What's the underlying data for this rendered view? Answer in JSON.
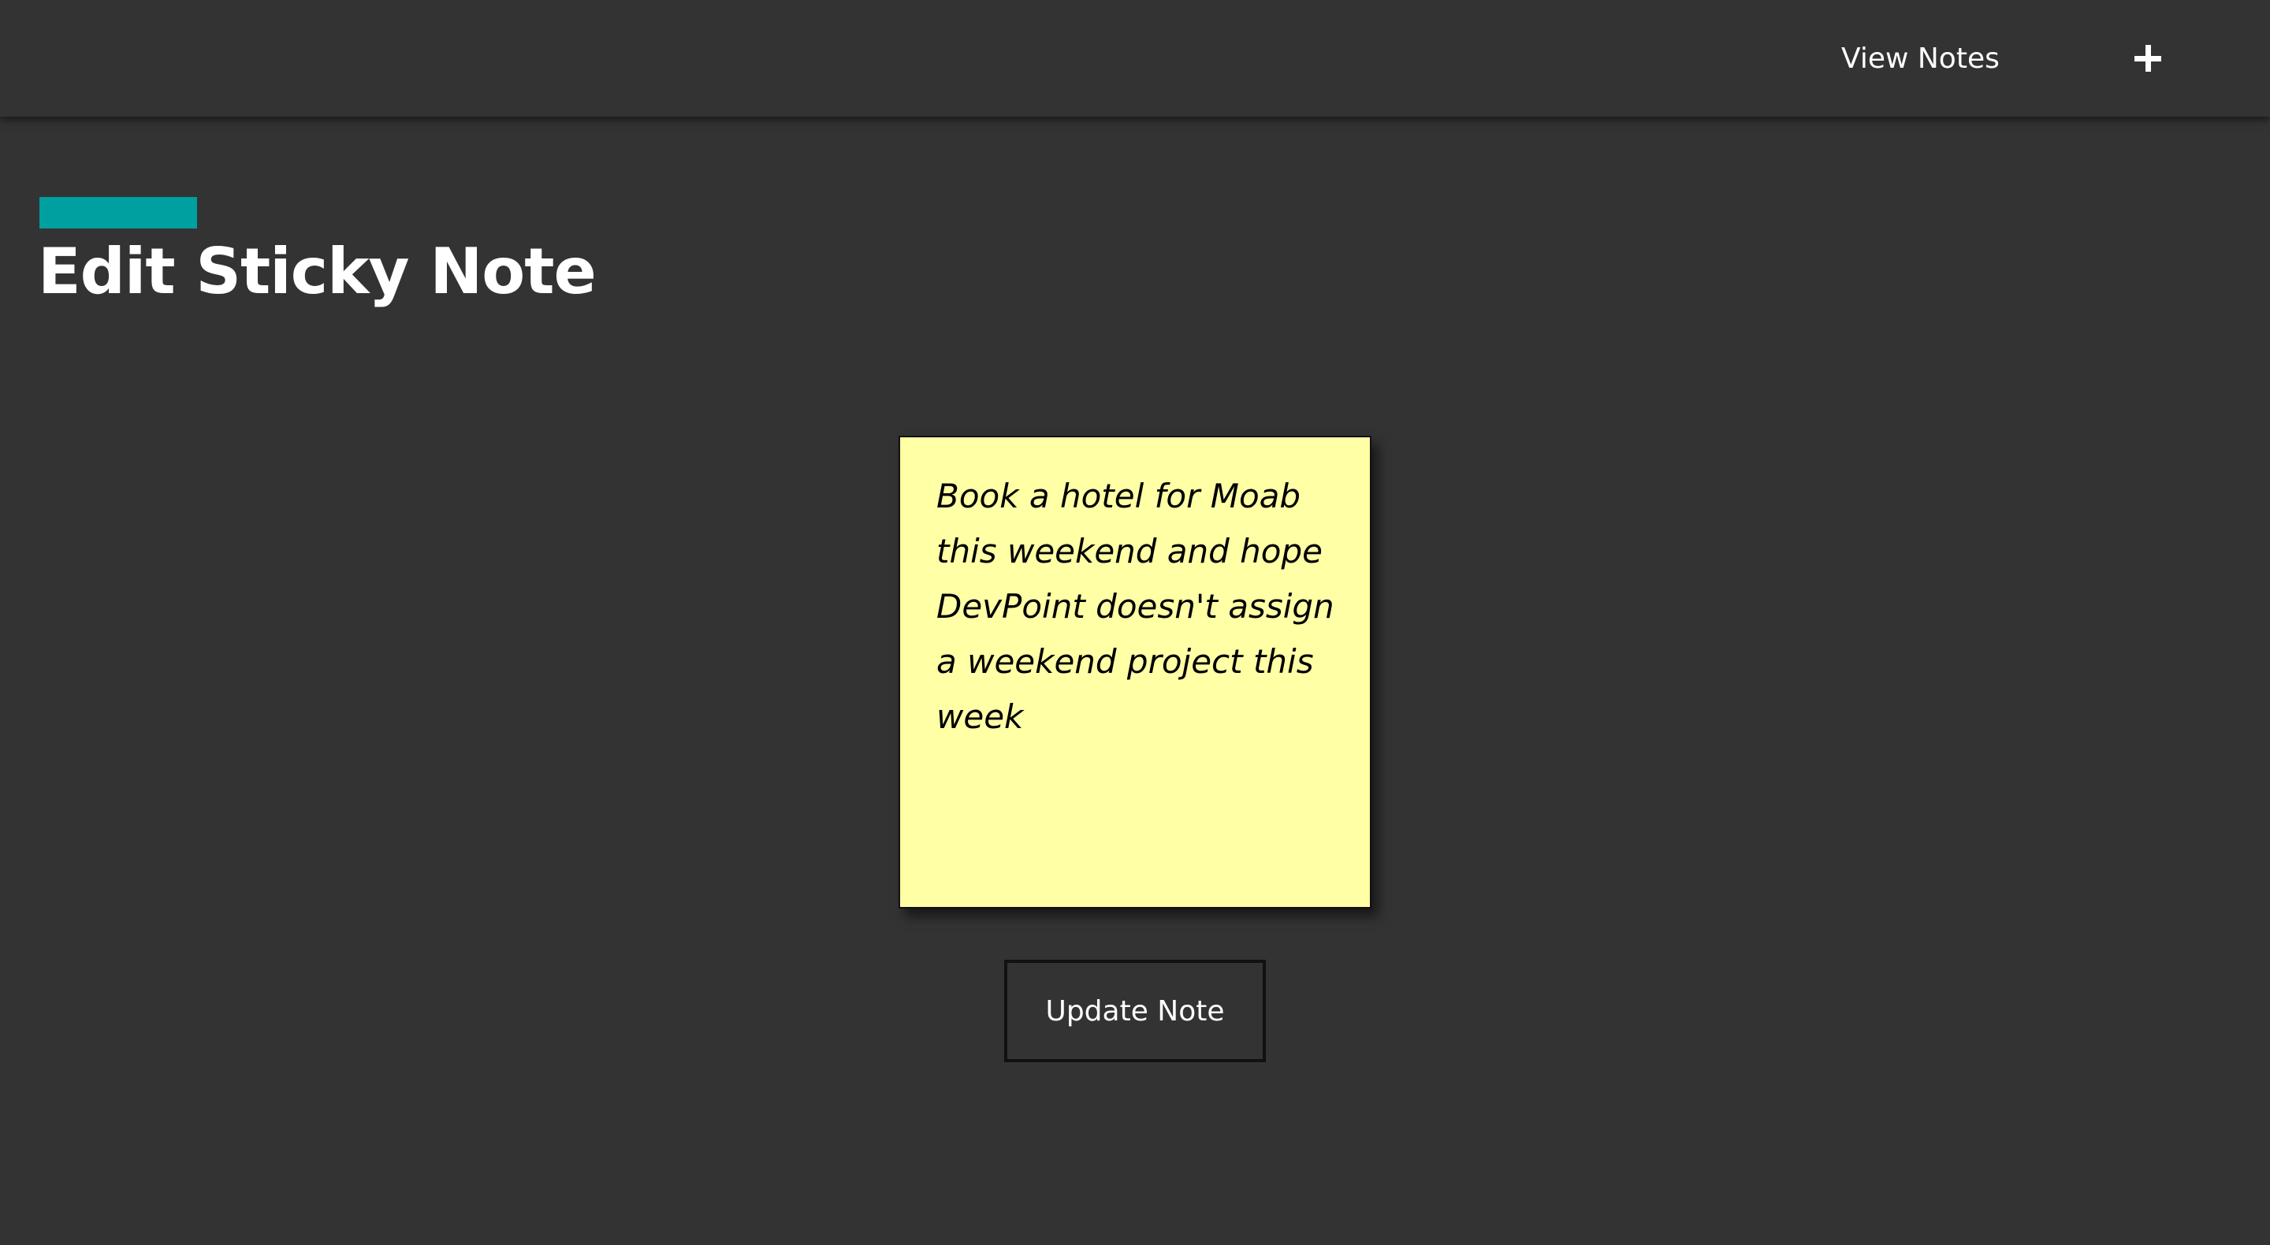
{
  "nav": {
    "view_notes_label": "View Notes",
    "add_note_icon": "plus-icon"
  },
  "page": {
    "title": "Edit Sticky Note",
    "accent_color": "#00A0A0",
    "background_color": "#333333"
  },
  "note": {
    "text": "Book a hotel for Moab this weekend and hope DevPoint doesn't assign a weekend project this week",
    "color": "#FFFFA5"
  },
  "actions": {
    "update_label": "Update Note"
  }
}
